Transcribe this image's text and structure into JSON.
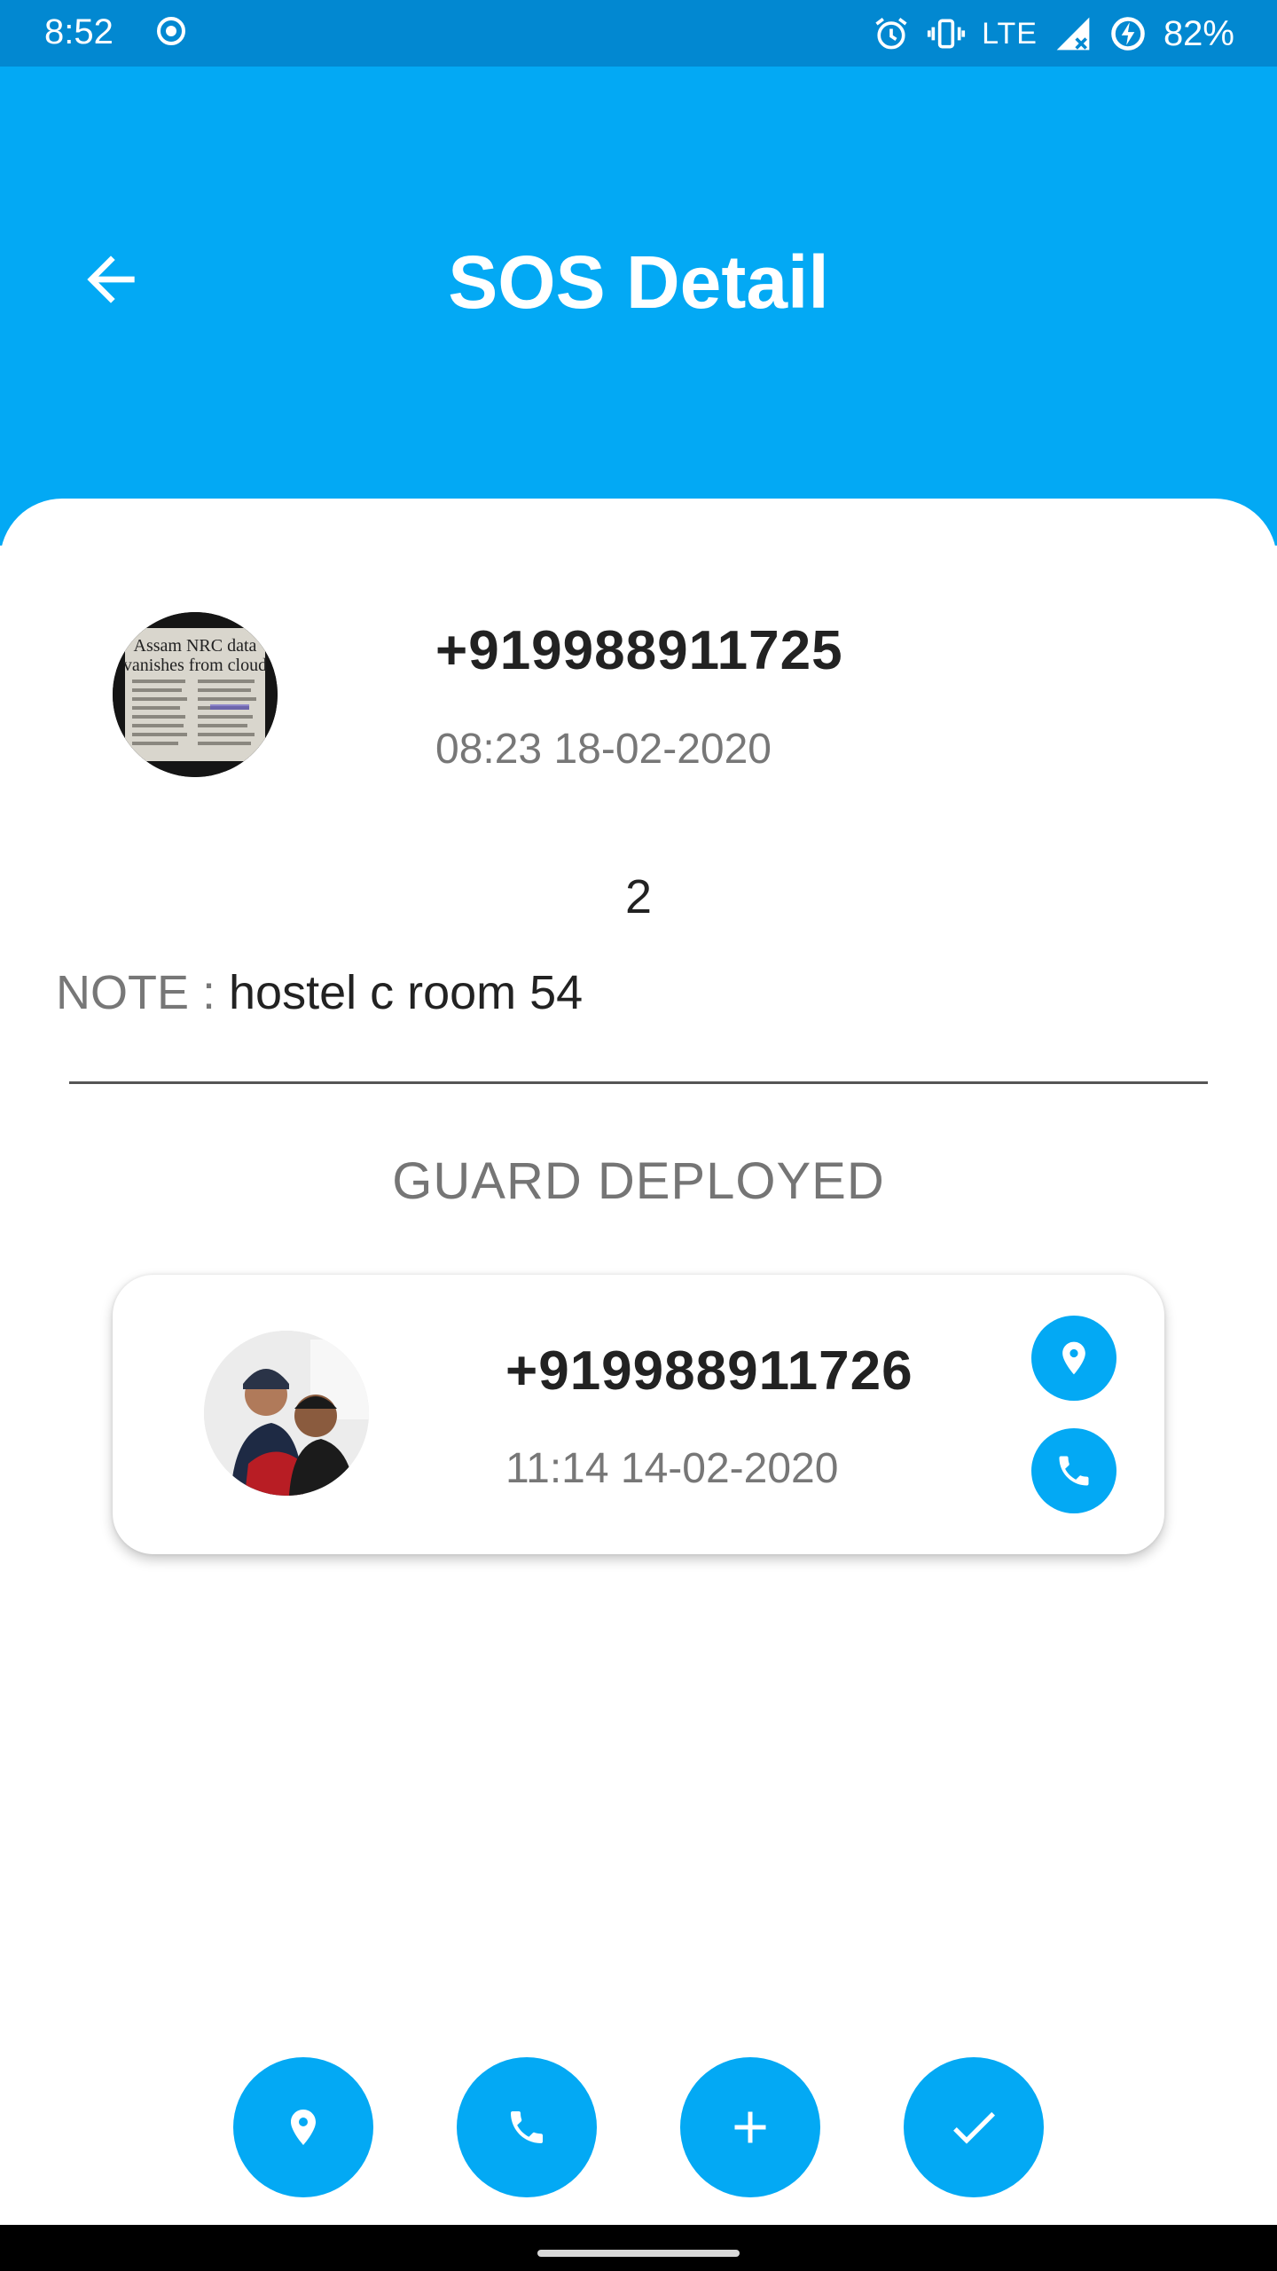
{
  "status_bar": {
    "time": "8:52",
    "network": "LTE",
    "battery": "82%",
    "icons": [
      "record-icon",
      "alarm-icon",
      "vibrate-icon",
      "signal-icon",
      "battery-charging-icon"
    ]
  },
  "app_bar": {
    "title": "SOS Detail",
    "back_icon": "arrow-back-icon",
    "color": "#03A9F4"
  },
  "reporter": {
    "phone": "+919988911725",
    "timestamp": "08:23 18-02-2020",
    "avatar_headline_1": "Assam NRC data",
    "avatar_headline_2": "vanishes from cloud"
  },
  "sos": {
    "count": "2",
    "note_label": "NOTE : ",
    "note_text": "hostel c room 54"
  },
  "guard_section": {
    "title": "GUARD DEPLOYED",
    "guard": {
      "phone": "+919988911726",
      "timestamp": "11:14 14-02-2020",
      "location_icon": "location-pin-icon",
      "call_icon": "phone-icon"
    }
  },
  "bottom_actions": [
    {
      "name": "location",
      "icon": "location-pin-icon"
    },
    {
      "name": "call",
      "icon": "phone-icon"
    },
    {
      "name": "add",
      "icon": "plus-icon"
    },
    {
      "name": "resolve",
      "icon": "check-icon"
    }
  ],
  "colors": {
    "accent": "#03A9F4",
    "status_bar": "#0288D1",
    "text_primary": "#222222",
    "text_secondary": "#777777"
  }
}
